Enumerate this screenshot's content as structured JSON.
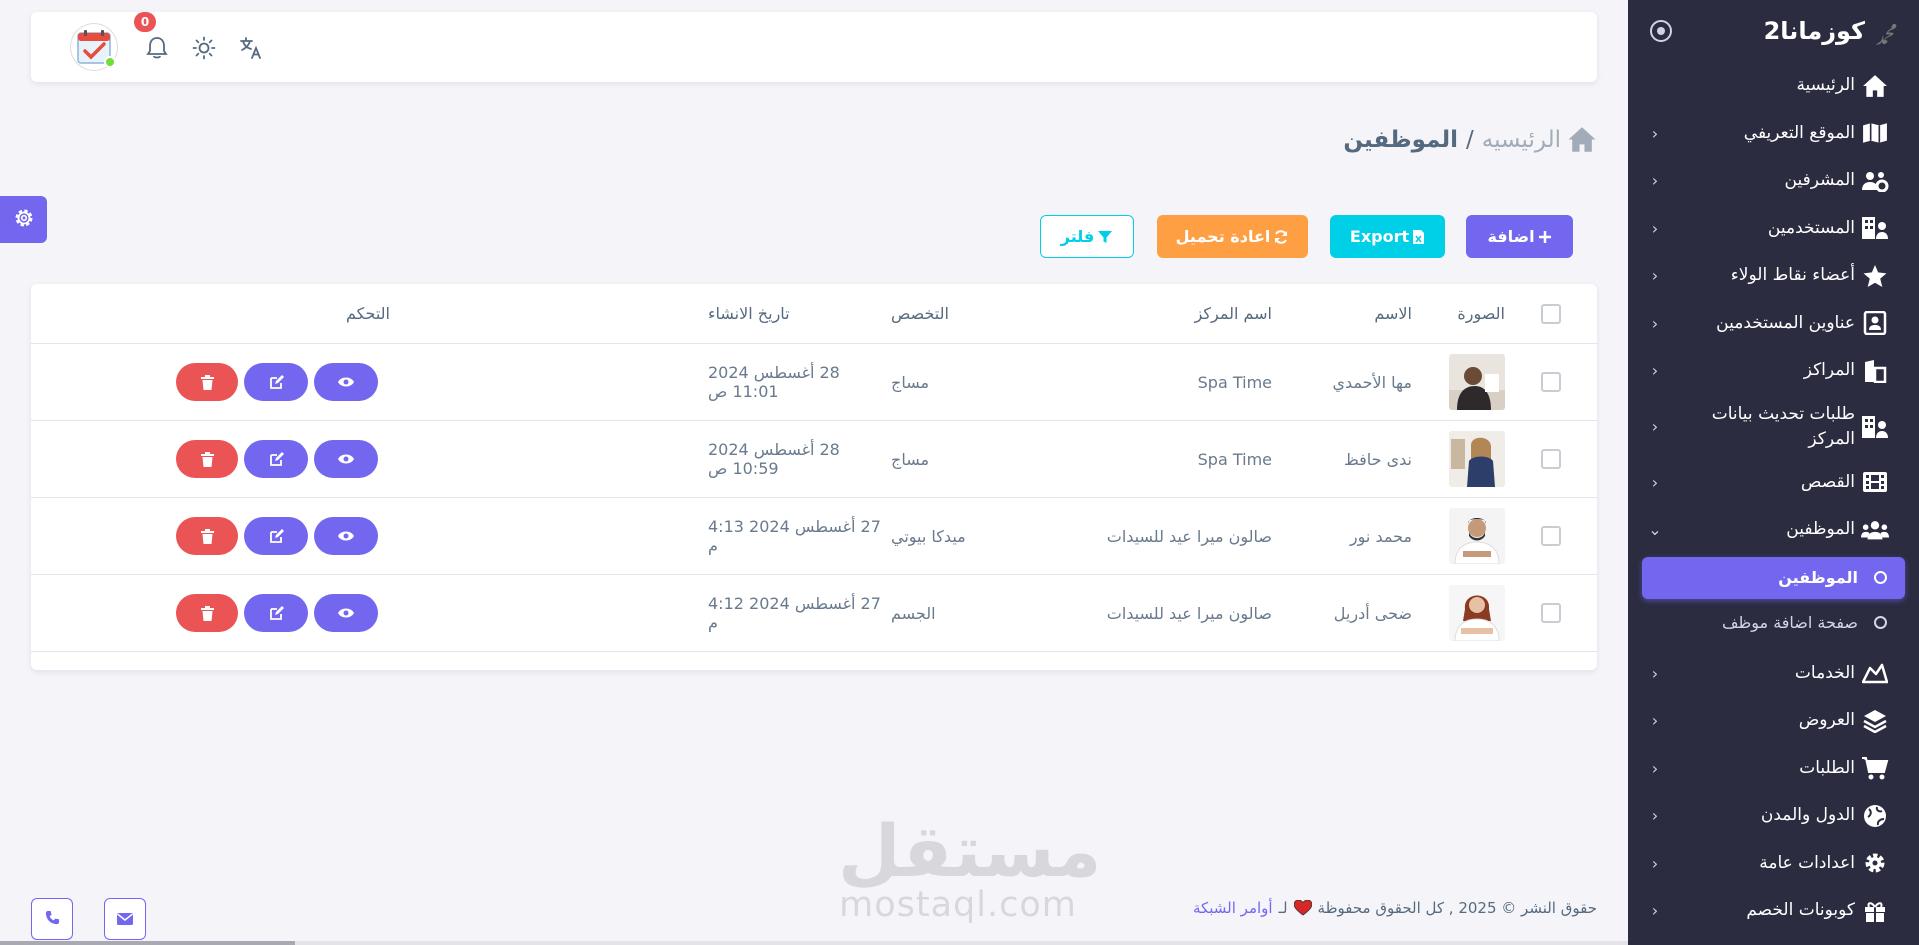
{
  "sidebar": {
    "brand": "كوزمانا2",
    "logo_text": "ﷴ",
    "items": [
      {
        "label": "الرئيسية",
        "icon": "home-icon",
        "chevron": false
      },
      {
        "label": "الموقع التعريفي",
        "icon": "map-icon",
        "chevron": true
      },
      {
        "label": "المشرفين",
        "icon": "users-gear-icon",
        "chevron": true
      },
      {
        "label": "المستخدمين",
        "icon": "building-user-icon",
        "chevron": true
      },
      {
        "label": "أعضاء نقاط الولاء",
        "icon": "star-icon",
        "chevron": true
      },
      {
        "label": "عناوين المستخدمين",
        "icon": "address-card-icon",
        "chevron": true
      },
      {
        "label": "المراكز",
        "icon": "store-icon",
        "chevron": true
      },
      {
        "label": "طلبات تحديث بيانات المركز",
        "icon": "building-user-icon",
        "chevron": true
      },
      {
        "label": "القصص",
        "icon": "film-icon",
        "chevron": true
      },
      {
        "label": "الموظفين",
        "icon": "users-icon",
        "chevron": true
      }
    ],
    "sub_items": [
      {
        "label": "الموظفين",
        "active": true
      },
      {
        "label": "صفحة اضافة موظف",
        "active": false
      }
    ],
    "items_after": [
      {
        "label": "الخدمات",
        "icon": "hand-icon",
        "chevron": true
      },
      {
        "label": "العروض",
        "icon": "layers-icon",
        "chevron": true
      },
      {
        "label": "الطلبات",
        "icon": "cart-icon",
        "chevron": true
      },
      {
        "label": "الدول والمدن",
        "icon": "globe-icon",
        "chevron": true
      },
      {
        "label": "اعدادات عامة",
        "icon": "gear-icon",
        "chevron": true
      },
      {
        "label": "كوبونات الخصم",
        "icon": "gift-icon",
        "chevron": true
      }
    ]
  },
  "topbar": {
    "notification_count": "0",
    "icons": [
      "translate-icon",
      "sun-icon",
      "bell-icon"
    ]
  },
  "breadcrumb": {
    "home": "الرئيسيه",
    "separator": "/",
    "current": "الموظفين"
  },
  "actions": {
    "add": "اضافة",
    "export": "Export",
    "reload": "اعادة تحميل",
    "filter": "فلتر"
  },
  "table": {
    "headers": {
      "photo": "الصورة",
      "name": "الاسم",
      "center": "اسم المركز",
      "specialty": "التخصص",
      "created": "تاريخ الانشاء",
      "control": "التحكم"
    },
    "rows": [
      {
        "name": "مها الأحمدي",
        "center": "Spa Time",
        "specialty": "مساج",
        "created": "28 أغسطس 2024 11:01 ص"
      },
      {
        "name": "ندى حافظ",
        "center": "Spa Time",
        "specialty": "مساج",
        "created": "28 أغسطس 2024 10:59 ص"
      },
      {
        "name": "محمد نور",
        "center": "صالون ميرا عيد للسيدات",
        "specialty": "ميدكا بيوتي",
        "created": "27 أغسطس 2024 4:13 م"
      },
      {
        "name": "ضحى أدريل",
        "center": "صالون ميرا عيد للسيدات",
        "specialty": "الجسم",
        "created": "27 أغسطس 2024 4:12 م"
      }
    ]
  },
  "footer": {
    "text": "حقوق النشر © 2025 , كل الحقوق محفوظة",
    "for": "لـ",
    "company": "أوامر الشبكة"
  },
  "watermark": {
    "arabic": "مستقل",
    "latin": "mostaql.com"
  },
  "colors": {
    "primary": "#7367f0",
    "info": "#00cfe8",
    "warning": "#ff9f43",
    "danger": "#ea5455",
    "sidebar_bg": "#2b2c40"
  }
}
